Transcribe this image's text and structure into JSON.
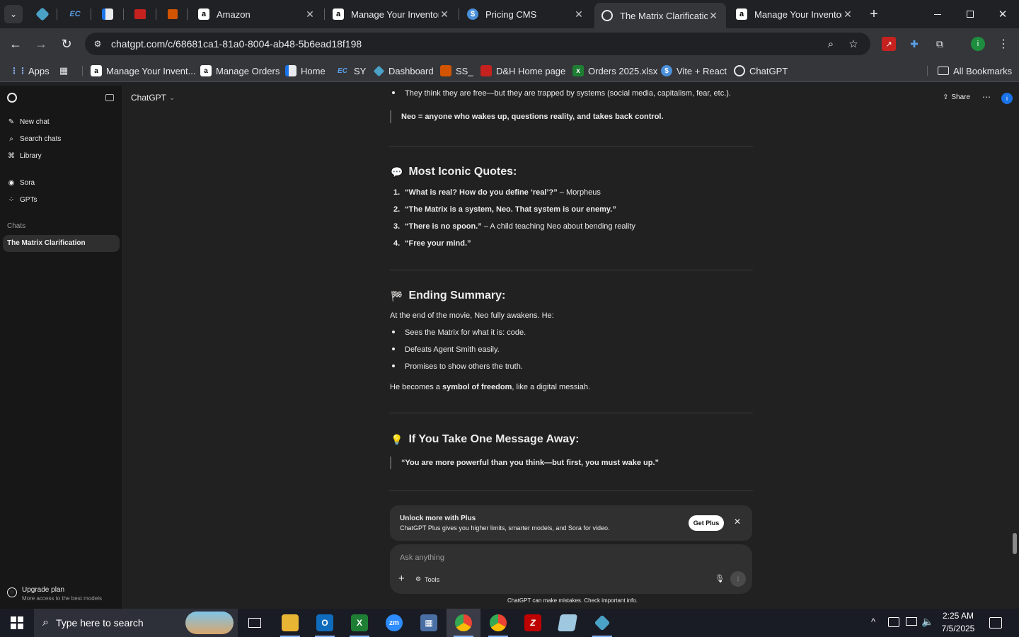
{
  "browser": {
    "tabs": [
      {
        "title": "Amazon",
        "favicon": "amazon-icon"
      },
      {
        "title": "Manage Your Inventor",
        "favicon": "amazon-icon"
      },
      {
        "title": "Pricing CMS",
        "favicon": "dollar-icon"
      },
      {
        "title": "The Matrix Clarificatio",
        "favicon": "chatgpt-icon",
        "active": true
      },
      {
        "title": "Manage Your Inventor",
        "favicon": "amazon-icon"
      }
    ],
    "url": "chatgpt.com/c/68681ca1-81a0-8004-ab48-5b6ead18f198",
    "bookmarks": [
      "Apps",
      "Manage Your Invent...",
      "Manage Orders",
      "Home",
      "SY",
      "Dashboard",
      "SS_",
      "D&H Home page",
      "Orders 2025.xlsx",
      "Vite + React",
      "ChatGPT"
    ],
    "all_bookmarks": "All Bookmarks",
    "profile_initial": "i"
  },
  "sidebar": {
    "items": [
      {
        "label": "New chat",
        "icon": "compose-icon"
      },
      {
        "label": "Search chats",
        "icon": "search-icon"
      },
      {
        "label": "Library",
        "icon": "library-icon"
      },
      {
        "label": "Sora",
        "icon": "sora-icon"
      },
      {
        "label": "GPTs",
        "icon": "gpts-icon"
      }
    ],
    "chats_heading": "Chats",
    "chats": [
      "The Matrix Clarification"
    ],
    "upgrade_title": "Upgrade plan",
    "upgrade_sub": "More access to the best models"
  },
  "header": {
    "model": "ChatGPT",
    "share": "Share"
  },
  "conversation": {
    "top_bullet": "They think they are free—but they are trapped by systems (social media, capitalism, fear, etc.).",
    "neo_quote": "Neo = anyone who wakes up, questions reality, and takes back control.",
    "quotes_heading": "Most Iconic Quotes:",
    "quotes": [
      {
        "n": "1.",
        "bold": "“What is real? How do you define ‘real’?”",
        "rest": " – Morpheus"
      },
      {
        "n": "2.",
        "bold": "“The Matrix is a system, Neo. That system is our enemy.”",
        "rest": ""
      },
      {
        "n": "3.",
        "bold": "“There is no spoon.”",
        "rest": " – A child teaching Neo about bending reality"
      },
      {
        "n": "4.",
        "bold": "“Free your mind.”",
        "rest": ""
      }
    ],
    "ending_heading": "Ending Summary:",
    "ending_intro": "At the end of the movie, Neo fully awakens. He:",
    "ending_bullets": [
      "Sees the Matrix for what it is: code.",
      "Defeats Agent Smith easily.",
      "Promises to show others the truth."
    ],
    "ending_outro_pre": "He becomes a ",
    "ending_outro_bold": "symbol of freedom",
    "ending_outro_post": ", like a digital messiah.",
    "message_heading": "If You Take One Message Away:",
    "message_quote": "“You are more powerful than you think—but first, you must wake up.”"
  },
  "upsell": {
    "title": "Unlock more with Plus",
    "body": "ChatGPT Plus gives you higher limits, smarter models, and Sora for video.",
    "button": "Get Plus"
  },
  "composer": {
    "placeholder": "Ask anything",
    "tools": "Tools",
    "disclaimer": "ChatGPT can make mistakes. Check important info."
  },
  "taskbar": {
    "search_placeholder": "Type here to search",
    "time": "2:25 AM",
    "date": "7/5/2025"
  },
  "colors": {
    "accent": "#8ab4f8",
    "sidebar_bg": "#171717",
    "main_bg": "#212121",
    "chrome_bg": "#35363a"
  }
}
